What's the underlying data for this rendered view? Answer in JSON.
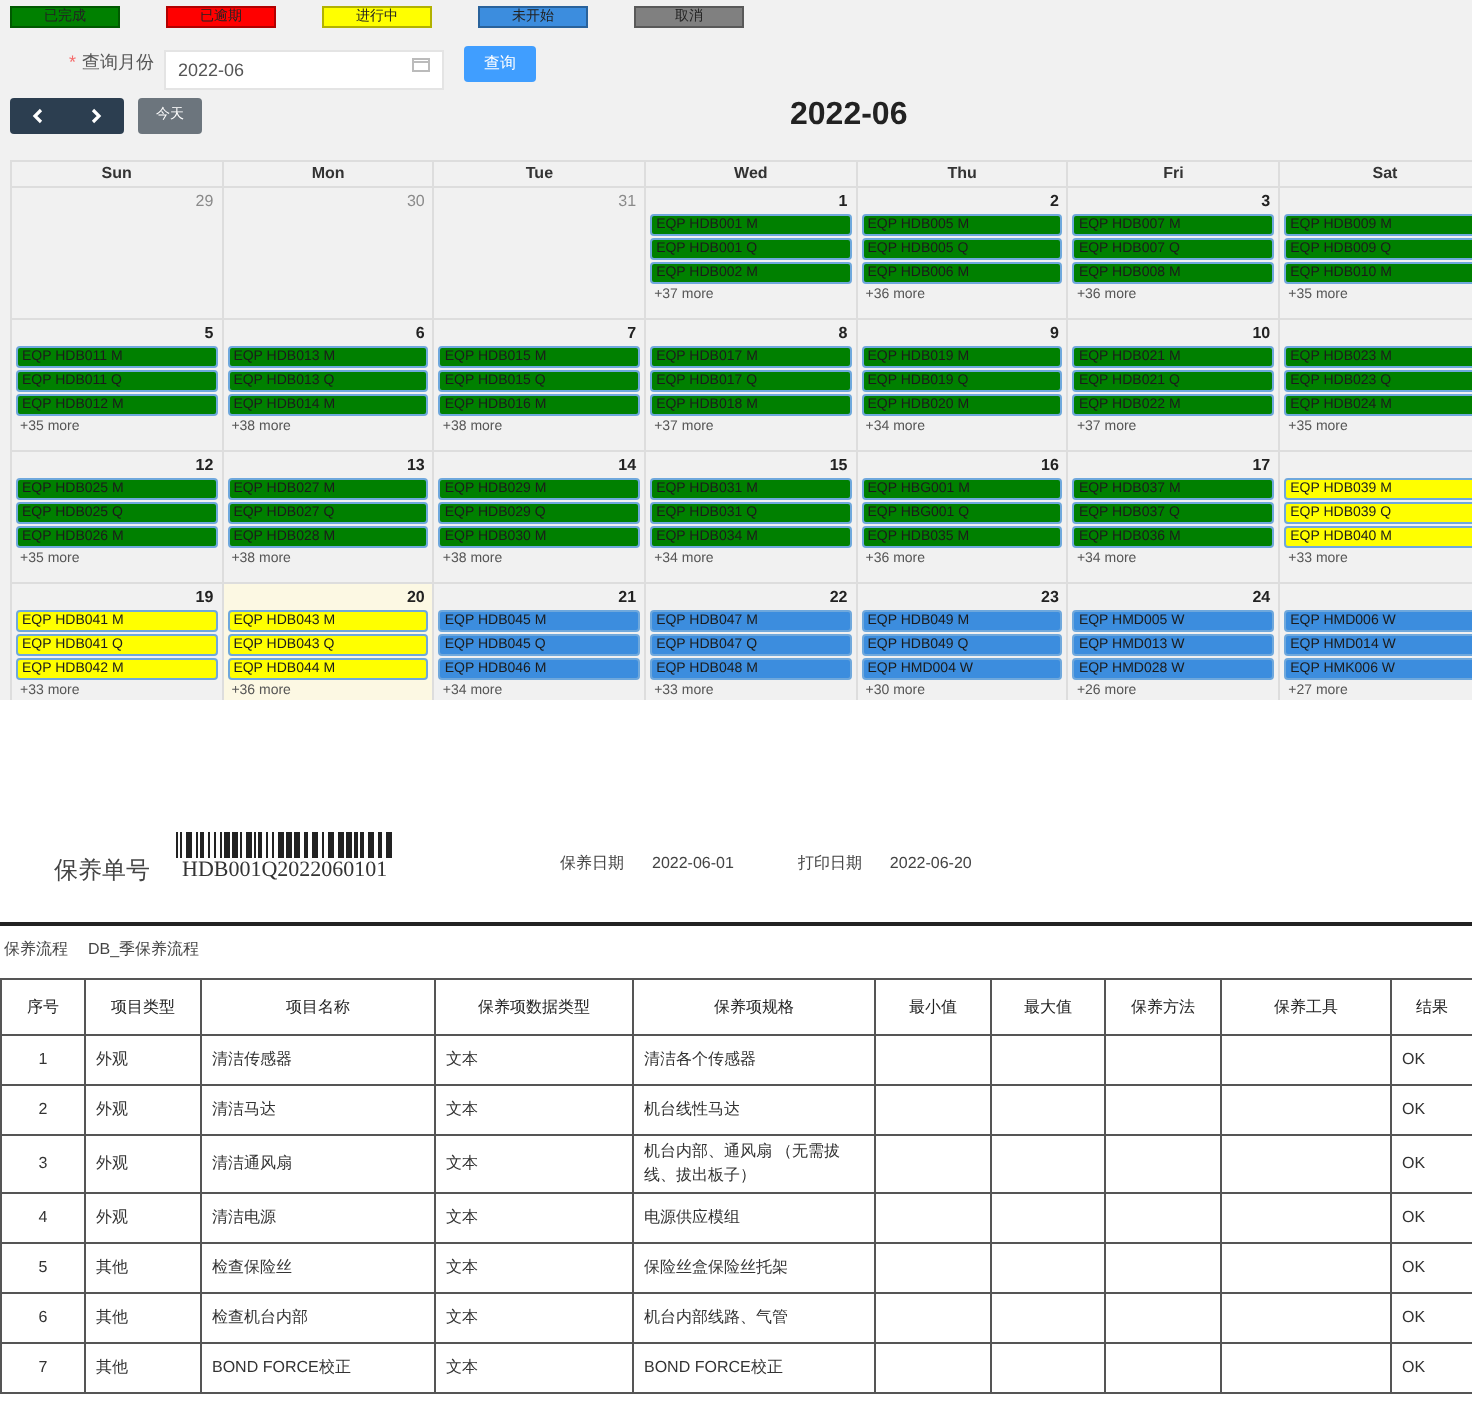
{
  "legend": [
    {
      "label": "已完成",
      "color": "#008000"
    },
    {
      "label": "已逾期",
      "color": "#ff0000"
    },
    {
      "label": "进行中",
      "color": "#ffff00"
    },
    {
      "label": "未开始",
      "color": "#3c8dde"
    },
    {
      "label": "取消",
      "color": "#808080"
    }
  ],
  "query": {
    "required_mark": "*",
    "label": "查询月份",
    "value": "2022-06",
    "button": "查询"
  },
  "toolbar": {
    "today_button": "今天",
    "title": "2022-06"
  },
  "calendar": {
    "weekdays": [
      "Sun",
      "Mon",
      "Tue",
      "Wed",
      "Thu",
      "Fri",
      "Sat"
    ],
    "weeks": [
      {
        "days": [
          {
            "day": "29",
            "other_month": true,
            "today": false
          },
          {
            "day": "30",
            "other_month": true,
            "today": false
          },
          {
            "day": "31",
            "other_month": true,
            "today": false
          },
          {
            "day": "1",
            "other_month": false,
            "today": false,
            "events": [
              {
                "label": "EQP HDB001 M",
                "color": "#008000"
              },
              {
                "label": "EQP HDB001 Q",
                "color": "#008000"
              },
              {
                "label": "EQP HDB002 M",
                "color": "#008000"
              }
            ],
            "more": "+37 more"
          },
          {
            "day": "2",
            "other_month": false,
            "today": false,
            "events": [
              {
                "label": "EQP HDB005 M",
                "color": "#008000"
              },
              {
                "label": "EQP HDB005 Q",
                "color": "#008000"
              },
              {
                "label": "EQP HDB006 M",
                "color": "#008000"
              }
            ],
            "more": "+36 more"
          },
          {
            "day": "3",
            "other_month": false,
            "today": false,
            "events": [
              {
                "label": "EQP HDB007 M",
                "color": "#008000"
              },
              {
                "label": "EQP HDB007 Q",
                "color": "#008000"
              },
              {
                "label": "EQP HDB008 M",
                "color": "#008000"
              }
            ],
            "more": "+36 more"
          },
          {
            "today": false,
            "events": [
              {
                "label": "EQP HDB009 M",
                "color": "#008000"
              },
              {
                "label": "EQP HDB009 Q",
                "color": "#008000"
              },
              {
                "label": "EQP HDB010 M",
                "color": "#008000"
              }
            ],
            "more": "+35 more"
          }
        ]
      },
      {
        "days": [
          {
            "day": "5",
            "other_month": false,
            "today": false,
            "events": [
              {
                "label": "EQP HDB011 M",
                "color": "#008000"
              },
              {
                "label": "EQP HDB011 Q",
                "color": "#008000"
              },
              {
                "label": "EQP HDB012 M",
                "color": "#008000"
              }
            ],
            "more": "+35 more"
          },
          {
            "day": "6",
            "other_month": false,
            "today": false,
            "events": [
              {
                "label": "EQP HDB013 M",
                "color": "#008000"
              },
              {
                "label": "EQP HDB013 Q",
                "color": "#008000"
              },
              {
                "label": "EQP HDB014 M",
                "color": "#008000"
              }
            ],
            "more": "+38 more"
          },
          {
            "day": "7",
            "other_month": false,
            "today": false,
            "events": [
              {
                "label": "EQP HDB015 M",
                "color": "#008000"
              },
              {
                "label": "EQP HDB015 Q",
                "color": "#008000"
              },
              {
                "label": "EQP HDB016 M",
                "color": "#008000"
              }
            ],
            "more": "+38 more"
          },
          {
            "day": "8",
            "other_month": false,
            "today": false,
            "events": [
              {
                "label": "EQP HDB017 M",
                "color": "#008000"
              },
              {
                "label": "EQP HDB017 Q",
                "color": "#008000"
              },
              {
                "label": "EQP HDB018 M",
                "color": "#008000"
              }
            ],
            "more": "+37 more"
          },
          {
            "day": "9",
            "other_month": false,
            "today": false,
            "events": [
              {
                "label": "EQP HDB019 M",
                "color": "#008000"
              },
              {
                "label": "EQP HDB019 Q",
                "color": "#008000"
              },
              {
                "label": "EQP HDB020 M",
                "color": "#008000"
              }
            ],
            "more": "+34 more"
          },
          {
            "day": "10",
            "other_month": false,
            "today": false,
            "events": [
              {
                "label": "EQP HDB021 M",
                "color": "#008000"
              },
              {
                "label": "EQP HDB021 Q",
                "color": "#008000"
              },
              {
                "label": "EQP HDB022 M",
                "color": "#008000"
              }
            ],
            "more": "+37 more"
          },
          {
            "today": false,
            "events": [
              {
                "label": "EQP HDB023 M",
                "color": "#008000"
              },
              {
                "label": "EQP HDB023 Q",
                "color": "#008000"
              },
              {
                "label": "EQP HDB024 M",
                "color": "#008000"
              }
            ],
            "more": "+35 more"
          }
        ]
      },
      {
        "days": [
          {
            "day": "12",
            "other_month": false,
            "today": false,
            "events": [
              {
                "label": "EQP HDB025 M",
                "color": "#008000"
              },
              {
                "label": "EQP HDB025 Q",
                "color": "#008000"
              },
              {
                "label": "EQP HDB026 M",
                "color": "#008000"
              }
            ],
            "more": "+35 more"
          },
          {
            "day": "13",
            "other_month": false,
            "today": false,
            "events": [
              {
                "label": "EQP HDB027 M",
                "color": "#008000"
              },
              {
                "label": "EQP HDB027 Q",
                "color": "#008000"
              },
              {
                "label": "EQP HDB028 M",
                "color": "#008000"
              }
            ],
            "more": "+38 more"
          },
          {
            "day": "14",
            "other_month": false,
            "today": false,
            "events": [
              {
                "label": "EQP HDB029 M",
                "color": "#008000"
              },
              {
                "label": "EQP HDB029 Q",
                "color": "#008000"
              },
              {
                "label": "EQP HDB030 M",
                "color": "#008000"
              }
            ],
            "more": "+38 more"
          },
          {
            "day": "15",
            "other_month": false,
            "today": false,
            "events": [
              {
                "label": "EQP HDB031 M",
                "color": "#008000"
              },
              {
                "label": "EQP HDB031 Q",
                "color": "#008000"
              },
              {
                "label": "EQP HDB034 M",
                "color": "#008000"
              }
            ],
            "more": "+34 more"
          },
          {
            "day": "16",
            "other_month": false,
            "today": false,
            "events": [
              {
                "label": "EQP HBG001 M",
                "color": "#008000"
              },
              {
                "label": "EQP HBG001 Q",
                "color": "#008000"
              },
              {
                "label": "EQP HDB035 M",
                "color": "#008000"
              }
            ],
            "more": "+36 more"
          },
          {
            "day": "17",
            "other_month": false,
            "today": false,
            "events": [
              {
                "label": "EQP HDB037 M",
                "color": "#008000"
              },
              {
                "label": "EQP HDB037 Q",
                "color": "#008000"
              },
              {
                "label": "EQP HDB036 M",
                "color": "#008000"
              }
            ],
            "more": "+34 more"
          },
          {
            "today": false,
            "events": [
              {
                "label": "EQP HDB039 M",
                "color": "#ffff00"
              },
              {
                "label": "EQP HDB039 Q",
                "color": "#ffff00"
              },
              {
                "label": "EQP HDB040 M",
                "color": "#ffff00"
              }
            ],
            "more": "+33 more"
          }
        ]
      },
      {
        "days": [
          {
            "day": "19",
            "other_month": false,
            "today": false,
            "events": [
              {
                "label": "EQP HDB041 M",
                "color": "#ffff00"
              },
              {
                "label": "EQP HDB041 Q",
                "color": "#ffff00"
              },
              {
                "label": "EQP HDB042 M",
                "color": "#ffff00"
              }
            ],
            "more": "+33 more"
          },
          {
            "day": "20",
            "other_month": false,
            "today": true,
            "events": [
              {
                "label": "EQP HDB043 M",
                "color": "#ffff00"
              },
              {
                "label": "EQP HDB043 Q",
                "color": "#ffff00"
              },
              {
                "label": "EQP HDB044 M",
                "color": "#ffff00"
              }
            ],
            "more": "+36 more"
          },
          {
            "day": "21",
            "other_month": false,
            "today": false,
            "events": [
              {
                "label": "EQP HDB045 M",
                "color": "#3c8dde"
              },
              {
                "label": "EQP HDB045 Q",
                "color": "#3c8dde"
              },
              {
                "label": "EQP HDB046 M",
                "color": "#3c8dde"
              }
            ],
            "more": "+34 more"
          },
          {
            "day": "22",
            "other_month": false,
            "today": false,
            "events": [
              {
                "label": "EQP HDB047 M",
                "color": "#3c8dde"
              },
              {
                "label": "EQP HDB047 Q",
                "color": "#3c8dde"
              },
              {
                "label": "EQP HDB048 M",
                "color": "#3c8dde"
              }
            ],
            "more": "+33 more"
          },
          {
            "day": "23",
            "other_month": false,
            "today": false,
            "events": [
              {
                "label": "EQP HDB049 M",
                "color": "#3c8dde"
              },
              {
                "label": "EQP HDB049 Q",
                "color": "#3c8dde"
              },
              {
                "label": "EQP HMD004 W",
                "color": "#3c8dde"
              }
            ],
            "more": "+30 more"
          },
          {
            "day": "24",
            "other_month": false,
            "today": false,
            "events": [
              {
                "label": "EQP HMD005 W",
                "color": "#3c8dde"
              },
              {
                "label": "EQP HMD013 W",
                "color": "#3c8dde"
              },
              {
                "label": "EQP HMD028 W",
                "color": "#3c8dde"
              }
            ],
            "more": "+26 more"
          },
          {
            "today": false,
            "events": [
              {
                "label": "EQP HMD006 W",
                "color": "#3c8dde"
              },
              {
                "label": "EQP HMD014 W",
                "color": "#3c8dde"
              },
              {
                "label": "EQP HMK006 W",
                "color": "#3c8dde"
              }
            ],
            "more": "+27 more"
          }
        ]
      }
    ]
  },
  "document": {
    "order_label": "保养单号",
    "order_number": "HDB001Q2022060101",
    "maint_date_label": "保养日期",
    "maint_date": "2022-06-01",
    "print_date_label": "打印日期",
    "print_date": "2022-06-20",
    "flow_label": "保养流程",
    "flow": "DB_季保养流程",
    "table": {
      "columns": [
        "序号",
        "项目类型",
        "项目名称",
        "保养项数据类型",
        "保养项规格",
        "最小值",
        "最大值",
        "保养方法",
        "保养工具",
        "结果"
      ],
      "rows": [
        [
          "1",
          "外观",
          "清洁传感器",
          "文本",
          "清洁各个传感器",
          null,
          null,
          null,
          null,
          "OK"
        ],
        [
          "2",
          "外观",
          "清洁马达",
          "文本",
          "机台线性马达",
          null,
          null,
          null,
          null,
          "OK"
        ],
        [
          "3",
          "外观",
          "清洁通风扇",
          "文本",
          "机台内部、通风扇 （无需拔线、拔出板子）",
          null,
          null,
          null,
          null,
          "OK"
        ],
        [
          "4",
          "外观",
          "清洁电源",
          "文本",
          "电源供应模组",
          null,
          null,
          null,
          null,
          "OK"
        ],
        [
          "5",
          "其他",
          "检查保险丝",
          "文本",
          "保险丝盒保险丝托架",
          null,
          null,
          null,
          null,
          "OK"
        ],
        [
          "6",
          "其他",
          "检查机台内部",
          "文本",
          "机台内部线路、气管",
          null,
          null,
          null,
          null,
          "OK"
        ],
        [
          "7",
          "其他",
          "BOND FORCE校正",
          "文本",
          "BOND FORCE校正",
          null,
          null,
          null,
          null,
          "OK"
        ]
      ]
    }
  }
}
